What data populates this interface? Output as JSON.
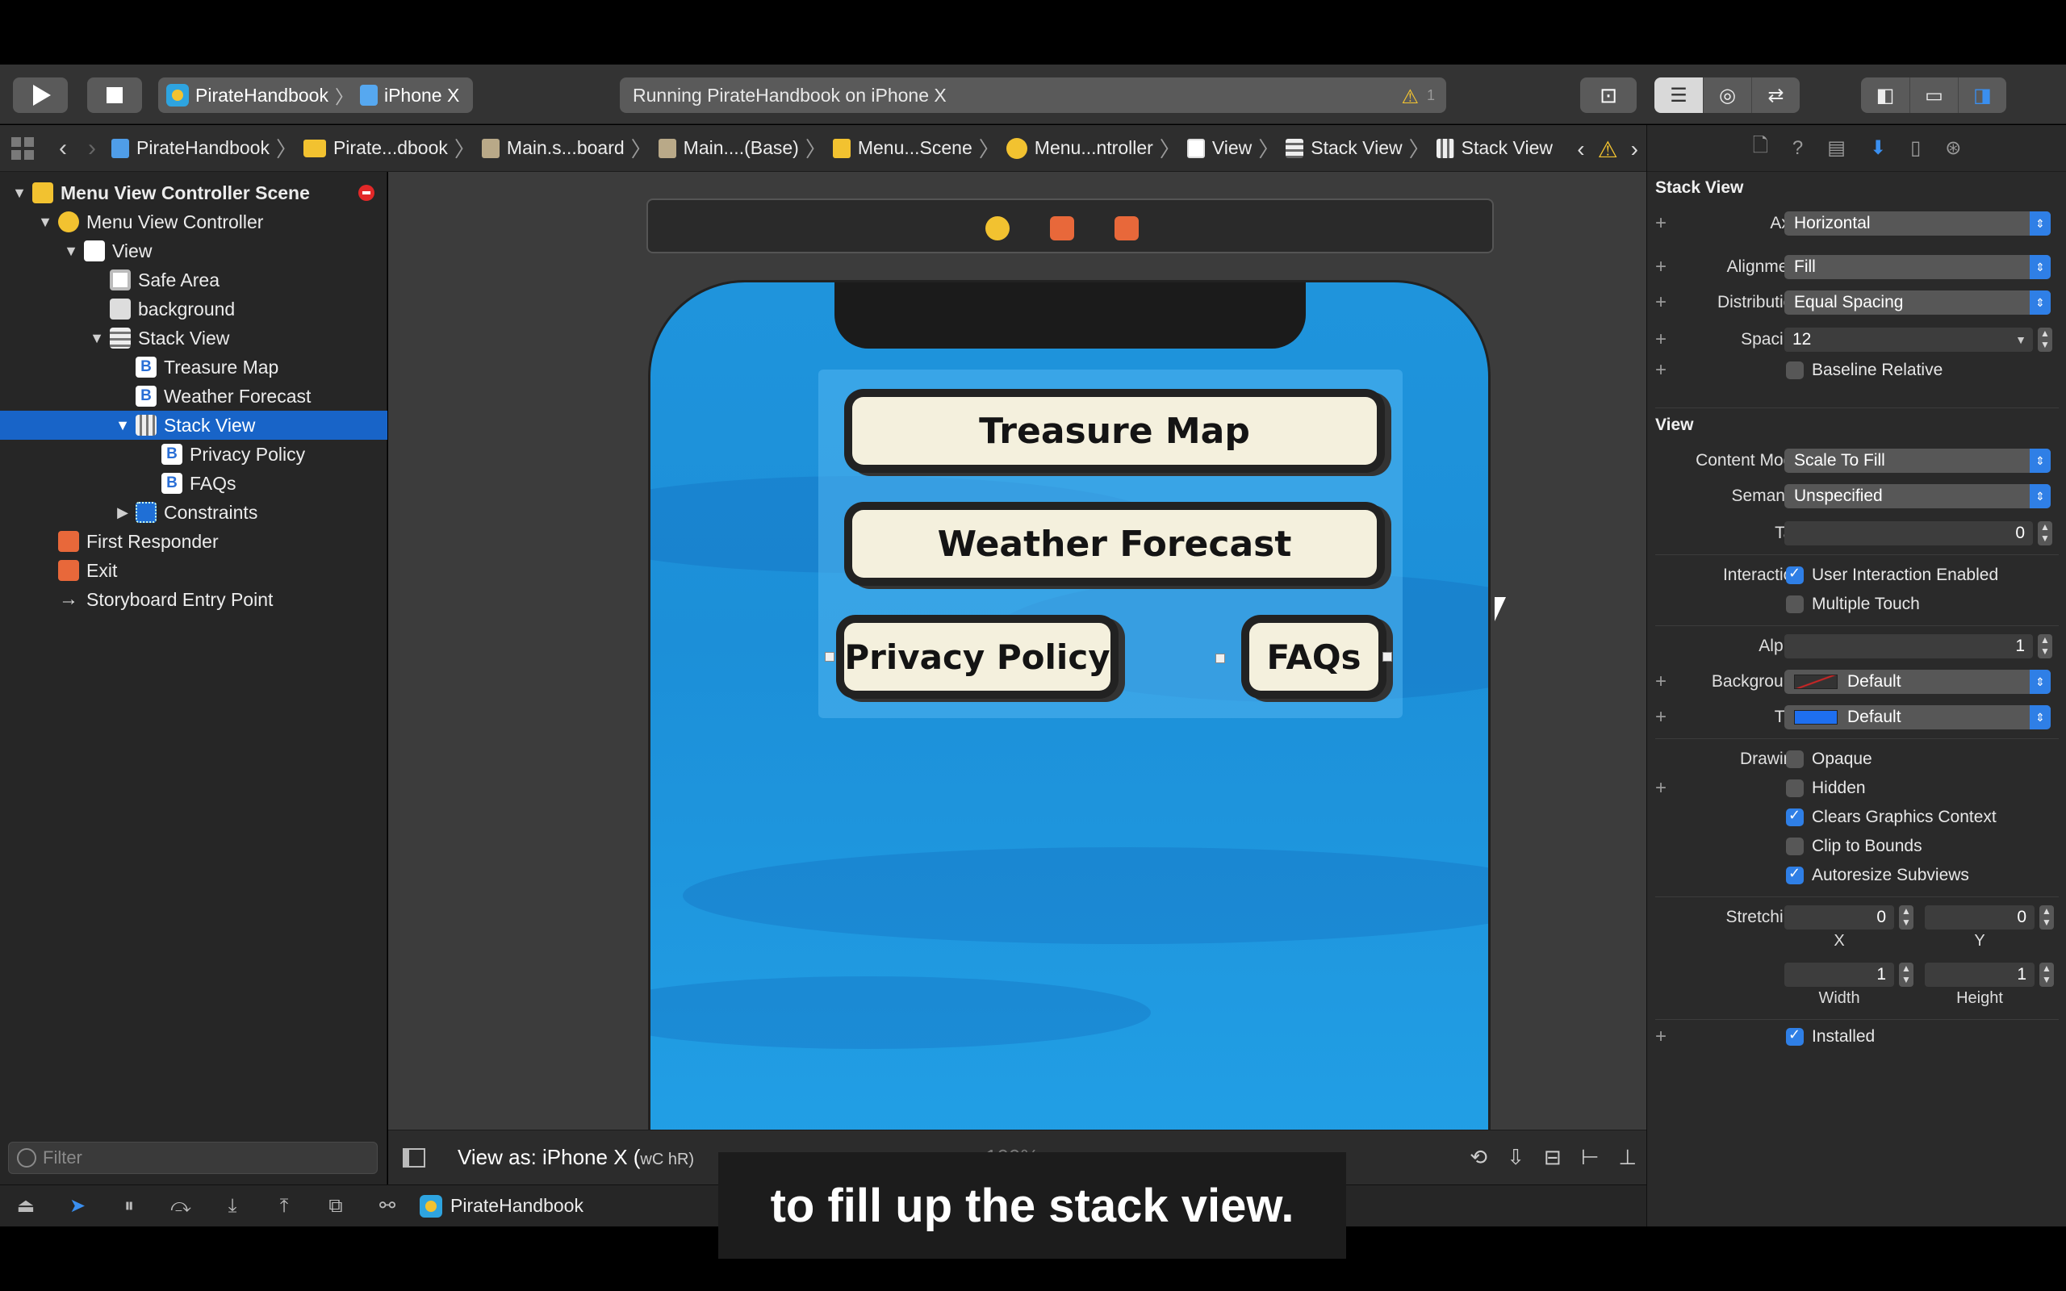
{
  "toolbar": {
    "scheme": "PirateHandbook",
    "device": "iPhone X",
    "status": "Running PirateHandbook on iPhone X",
    "warning_count": "1"
  },
  "jumpbar": {
    "crumbs": [
      "PirateHandbook",
      "Pirate...dbook",
      "Main.s...board",
      "Main....(Base)",
      "Menu...Scene",
      "Menu...ntroller",
      "View",
      "Stack View",
      "Stack View"
    ]
  },
  "navigator": {
    "items": [
      {
        "label": "Menu View Controller Scene"
      },
      {
        "label": "Menu View Controller"
      },
      {
        "label": "View"
      },
      {
        "label": "Safe Area"
      },
      {
        "label": "background"
      },
      {
        "label": "Stack View"
      },
      {
        "label": "Treasure Map"
      },
      {
        "label": "Weather Forecast"
      },
      {
        "label": "Stack View"
      },
      {
        "label": "Privacy Policy"
      },
      {
        "label": "FAQs"
      },
      {
        "label": "Constraints"
      },
      {
        "label": "First Responder"
      },
      {
        "label": "Exit"
      },
      {
        "label": "Storyboard Entry Point"
      }
    ],
    "filter_placeholder": "Filter"
  },
  "canvas": {
    "buttons": {
      "treasure": "Treasure Map",
      "weather": "Weather Forecast",
      "privacy": "Privacy Policy",
      "faqs": "FAQs"
    },
    "view_as": "View as: iPhone X (",
    "view_as_size": "wC hR)",
    "zoom": "100%"
  },
  "bottombar": {
    "target": "PirateHandbook"
  },
  "inspector": {
    "stack_section": "Stack View",
    "axis_label": "Axis",
    "axis_value": "Horizontal",
    "alignment_label": "Alignment",
    "alignment_value": "Fill",
    "distribution_label": "Distribution",
    "distribution_value": "Equal Spacing",
    "spacing_label": "Spacing",
    "spacing_value": "12",
    "baseline_label": "Baseline Relative",
    "view_section": "View",
    "content_mode_label": "Content Mode",
    "content_mode_value": "Scale To Fill",
    "semantic_label": "Semantic",
    "semantic_value": "Unspecified",
    "tag_label": "Tag",
    "tag_value": "0",
    "interaction_label": "Interaction",
    "user_interaction": "User Interaction Enabled",
    "multiple_touch": "Multiple Touch",
    "alpha_label": "Alpha",
    "alpha_value": "1",
    "background_label": "Background",
    "background_value": "Default",
    "tint_label": "Tint",
    "tint_value": "Default",
    "drawing_label": "Drawing",
    "opaque": "Opaque",
    "hidden": "Hidden",
    "clears": "Clears Graphics Context",
    "clip": "Clip to Bounds",
    "autoresize": "Autoresize Subviews",
    "stretching_label": "Stretching",
    "stretch_x": "0",
    "stretch_y": "0",
    "stretch_w": "1",
    "stretch_h": "1",
    "x_label": "X",
    "y_label": "Y",
    "w_label": "Width",
    "h_label": "Height",
    "installed": "Installed"
  },
  "caption": "to fill up the stack view.",
  "colors": {
    "accent": "#2f7fe6",
    "selection": "#1864c8",
    "sky": "#1f94dc"
  }
}
